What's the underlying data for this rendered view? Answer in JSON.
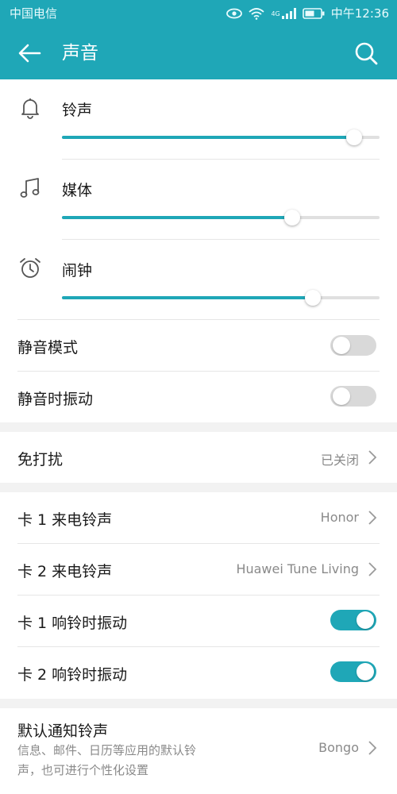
{
  "status_bar": {
    "carrier": "中国电信",
    "network_label": "4G",
    "time": "中午12:36"
  },
  "app_bar": {
    "title": "声音"
  },
  "volume": {
    "ringtone": {
      "label": "铃声",
      "level": 0.92
    },
    "media": {
      "label": "媒体",
      "level": 0.725
    },
    "alarm": {
      "label": "闹钟",
      "level": 0.79
    }
  },
  "silent": {
    "silent_mode": {
      "label": "静音模式",
      "on": false
    },
    "vibrate_silent": {
      "label": "静音时振动",
      "on": false
    }
  },
  "dnd": {
    "label": "免打扰",
    "value": "已关闭"
  },
  "ringtones": {
    "card1_ringtone": {
      "label": "卡 1 来电铃声",
      "value": "Honor"
    },
    "card2_ringtone": {
      "label": "卡 2 来电铃声",
      "value": "Huawei Tune Living"
    },
    "card1_vibrate": {
      "label": "卡 1 响铃时振动",
      "on": true
    },
    "card2_vibrate": {
      "label": "卡 2 响铃时振动",
      "on": true
    }
  },
  "notification": {
    "label": "默认通知铃声",
    "description_line1": "信息、邮件、日历等应用的默认铃",
    "description_line2": "声，也可进行个性化设置",
    "value": "Bongo"
  },
  "colors": {
    "accent": "#1fa7b7",
    "track": "#e0e0e0",
    "background": "#f2f2f2"
  }
}
